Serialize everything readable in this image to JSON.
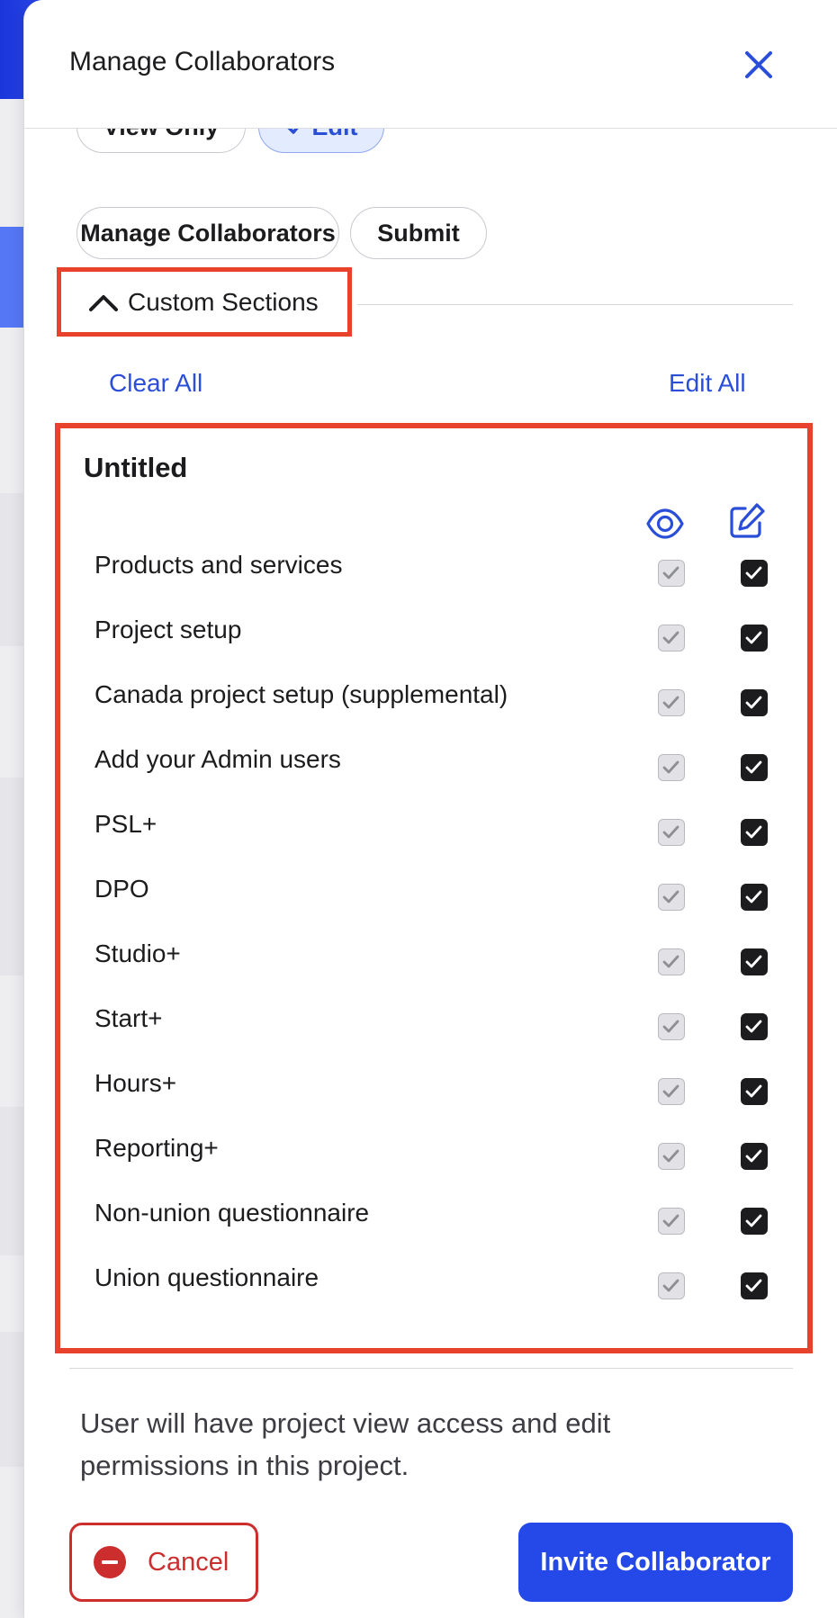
{
  "dialog": {
    "title": "Manage Collaborators"
  },
  "access_options": {
    "view_only": "View Only",
    "edit": "Edit"
  },
  "role_buttons": {
    "manage": "Manage Collaborators",
    "submit": "Submit"
  },
  "custom_sections": {
    "toggle_label": "Custom Sections",
    "clear_all": "Clear All",
    "edit_all": "Edit All",
    "group": {
      "title": "Untitled",
      "rows": [
        {
          "label": "Products and services",
          "view": true,
          "edit": true
        },
        {
          "label": "Project setup",
          "view": true,
          "edit": true
        },
        {
          "label": "Canada project setup (supplemental)",
          "view": true,
          "edit": true
        },
        {
          "label": "Add your Admin users",
          "view": true,
          "edit": true
        },
        {
          "label": "PSL+",
          "view": true,
          "edit": true
        },
        {
          "label": "DPO",
          "view": true,
          "edit": true
        },
        {
          "label": "Studio+",
          "view": true,
          "edit": true
        },
        {
          "label": "Start+",
          "view": true,
          "edit": true
        },
        {
          "label": "Hours+",
          "view": true,
          "edit": true
        },
        {
          "label": "Reporting+",
          "view": true,
          "edit": true
        },
        {
          "label": "Non-union questionnaire",
          "view": true,
          "edit": true
        },
        {
          "label": "Union questionnaire",
          "view": true,
          "edit": true
        }
      ]
    }
  },
  "description": "User will have project view access and edit permissions in this project.",
  "footer": {
    "cancel": "Cancel",
    "invite": "Invite Collaborator"
  },
  "colors": {
    "accent": "#2548e8",
    "highlight_border": "#e8412c",
    "danger": "#cc2d2d",
    "checked_edit": "#1c1c1e",
    "checked_view_disabled": "#e2e2e6"
  },
  "icons": {
    "close": "close-icon",
    "chevron": "chevron-up-icon",
    "view_column": "eye-icon",
    "edit_column": "pencil-square-icon",
    "checkmark": "check-icon",
    "cancel": "minus-circle-icon"
  }
}
